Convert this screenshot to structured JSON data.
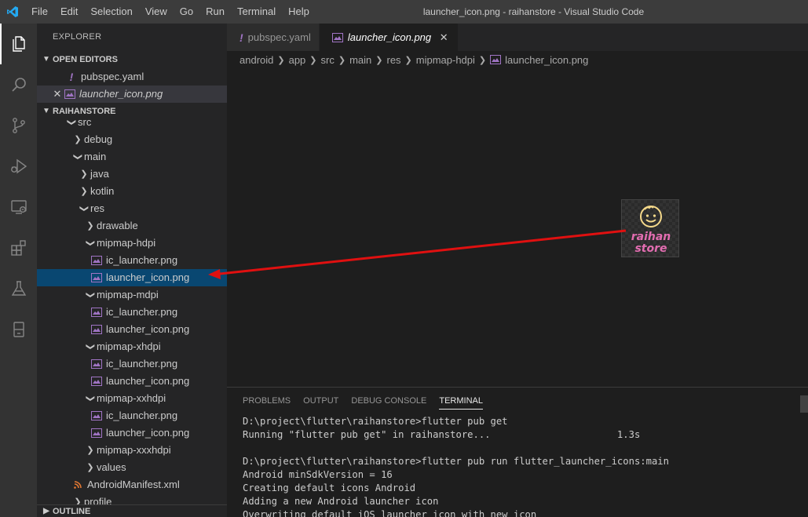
{
  "titlebar": {
    "menu": [
      "File",
      "Edit",
      "Selection",
      "View",
      "Go",
      "Run",
      "Terminal",
      "Help"
    ],
    "window_title": "launcher_icon.png - raihanstore - Visual Studio Code"
  },
  "activitybar": {
    "icons": [
      "explorer-icon",
      "search-icon",
      "source-control-icon",
      "run-debug-icon",
      "remote-explorer-icon",
      "extensions-icon",
      "testing-icon",
      "device-icon"
    ]
  },
  "sidebar": {
    "title": "EXPLORER",
    "open_editors": {
      "header": "OPEN EDITORS",
      "items": [
        {
          "label": "pubspec.yaml",
          "icon": "yaml-icon"
        },
        {
          "label": "launcher_icon.png",
          "icon": "image-file-icon"
        }
      ]
    },
    "project": {
      "header": "RAIHANSTORE",
      "tree": [
        {
          "label": "src",
          "type": "folder-open"
        },
        {
          "label": "debug",
          "type": "folder"
        },
        {
          "label": "main",
          "type": "folder-open"
        },
        {
          "label": "java",
          "type": "folder"
        },
        {
          "label": "kotlin",
          "type": "folder"
        },
        {
          "label": "res",
          "type": "folder-open"
        },
        {
          "label": "drawable",
          "type": "folder"
        },
        {
          "label": "mipmap-hdpi",
          "type": "folder-open"
        },
        {
          "label": "ic_launcher.png",
          "type": "image"
        },
        {
          "label": "launcher_icon.png",
          "type": "image"
        },
        {
          "label": "mipmap-mdpi",
          "type": "folder-open"
        },
        {
          "label": "ic_launcher.png",
          "type": "image"
        },
        {
          "label": "launcher_icon.png",
          "type": "image"
        },
        {
          "label": "mipmap-xhdpi",
          "type": "folder-open"
        },
        {
          "label": "ic_launcher.png",
          "type": "image"
        },
        {
          "label": "launcher_icon.png",
          "type": "image"
        },
        {
          "label": "mipmap-xxhdpi",
          "type": "folder-open"
        },
        {
          "label": "ic_launcher.png",
          "type": "image"
        },
        {
          "label": "launcher_icon.png",
          "type": "image"
        },
        {
          "label": "mipmap-xxxhdpi",
          "type": "folder"
        },
        {
          "label": "values",
          "type": "folder"
        },
        {
          "label": "AndroidManifest.xml",
          "type": "xml"
        },
        {
          "label": "profile",
          "type": "folder"
        }
      ]
    },
    "outline": {
      "header": "OUTLINE"
    }
  },
  "tabs": [
    {
      "label": "pubspec.yaml",
      "active": false
    },
    {
      "label": "launcher_icon.png",
      "active": true
    }
  ],
  "breadcrumb": [
    "android",
    "app",
    "src",
    "main",
    "res",
    "mipmap-hdpi",
    "launcher_icon.png"
  ],
  "preview": {
    "line1": "raihan",
    "line2": "store"
  },
  "panel": {
    "tabs": [
      "PROBLEMS",
      "OUTPUT",
      "DEBUG CONSOLE",
      "TERMINAL"
    ],
    "active_tab": "TERMINAL",
    "terminal_lines": [
      "D:\\project\\flutter\\raihanstore>flutter pub get",
      "Running \"flutter pub get\" in raihanstore...                      1.3s",
      "",
      "D:\\project\\flutter\\raihanstore>flutter pub run flutter_launcher_icons:main",
      "Android minSdkVersion = 16",
      "Creating default icons Android",
      "Adding a new Android launcher icon",
      "Overwriting default iOS launcher icon with new icon"
    ]
  },
  "colors": {
    "accent_selection": "#094771",
    "annotation_arrow": "#e01010",
    "yaml_icon": "#a074c4"
  }
}
